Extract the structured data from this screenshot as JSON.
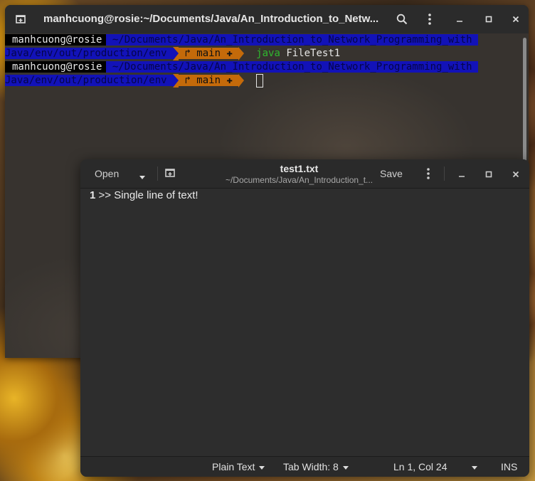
{
  "terminal": {
    "title": "manhcuong@rosie:~/Documents/Java/An_Introduction_to_Netw...",
    "lines": [
      {
        "user": "manhcuong@rosie",
        "path_a": " ~/Documents/Java/An_Introduction_to_Network_Programming_with ",
        "path_b": "Java/env/out/production/env ",
        "branch": " ↱ main ✚ ",
        "cmd": "java",
        "arg": " FileTest1"
      },
      {
        "user": "manhcuong@rosie",
        "path_a": " ~/Documents/Java/An_Introduction_to_Network_Programming_with ",
        "path_b": "Java/env/out/production/env ",
        "branch": " ↱ main ✚ "
      }
    ],
    "colors": {
      "path_bg": "#1212b8",
      "git_bg": "#c46a0a",
      "cmd": "#2fb82f"
    }
  },
  "gedit": {
    "open_label": "Open",
    "title": "test1.txt",
    "subtitle": "~/Documents/Java/An_Introduction_t...",
    "save_label": "Save",
    "content": {
      "line_no": "1",
      "text": " >> Single line of text!"
    },
    "footer": {
      "language": "Plain Text",
      "tab_width": "Tab Width: 8",
      "position": "Ln 1, Col 24",
      "mode": "INS"
    }
  },
  "icons": [
    "new-tab-icon",
    "search-icon",
    "menu-icon",
    "minimize-icon",
    "maximize-icon",
    "close-icon",
    "new-document-icon",
    "chevron-down-icon"
  ]
}
